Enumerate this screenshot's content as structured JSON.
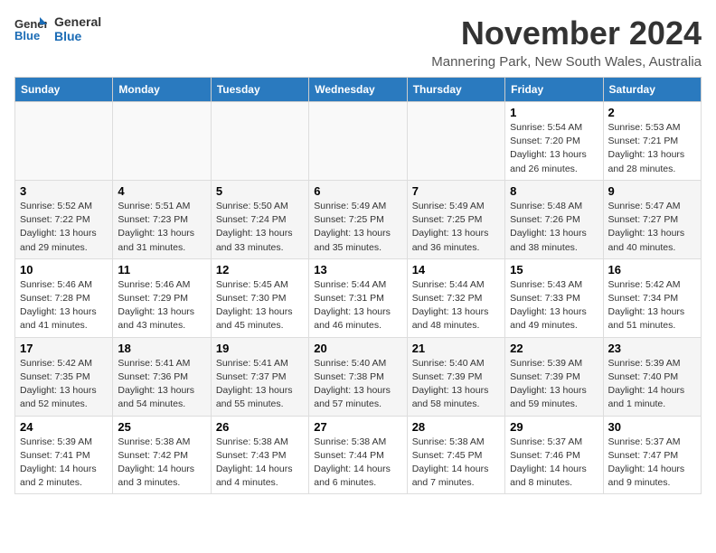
{
  "logo": {
    "line1": "General",
    "line2": "Blue"
  },
  "title": "November 2024",
  "location": "Mannering Park, New South Wales, Australia",
  "weekdays": [
    "Sunday",
    "Monday",
    "Tuesday",
    "Wednesday",
    "Thursday",
    "Friday",
    "Saturday"
  ],
  "weeks": [
    [
      {
        "day": "",
        "info": ""
      },
      {
        "day": "",
        "info": ""
      },
      {
        "day": "",
        "info": ""
      },
      {
        "day": "",
        "info": ""
      },
      {
        "day": "",
        "info": ""
      },
      {
        "day": "1",
        "info": "Sunrise: 5:54 AM\nSunset: 7:20 PM\nDaylight: 13 hours\nand 26 minutes."
      },
      {
        "day": "2",
        "info": "Sunrise: 5:53 AM\nSunset: 7:21 PM\nDaylight: 13 hours\nand 28 minutes."
      }
    ],
    [
      {
        "day": "3",
        "info": "Sunrise: 5:52 AM\nSunset: 7:22 PM\nDaylight: 13 hours\nand 29 minutes."
      },
      {
        "day": "4",
        "info": "Sunrise: 5:51 AM\nSunset: 7:23 PM\nDaylight: 13 hours\nand 31 minutes."
      },
      {
        "day": "5",
        "info": "Sunrise: 5:50 AM\nSunset: 7:24 PM\nDaylight: 13 hours\nand 33 minutes."
      },
      {
        "day": "6",
        "info": "Sunrise: 5:49 AM\nSunset: 7:25 PM\nDaylight: 13 hours\nand 35 minutes."
      },
      {
        "day": "7",
        "info": "Sunrise: 5:49 AM\nSunset: 7:25 PM\nDaylight: 13 hours\nand 36 minutes."
      },
      {
        "day": "8",
        "info": "Sunrise: 5:48 AM\nSunset: 7:26 PM\nDaylight: 13 hours\nand 38 minutes."
      },
      {
        "day": "9",
        "info": "Sunrise: 5:47 AM\nSunset: 7:27 PM\nDaylight: 13 hours\nand 40 minutes."
      }
    ],
    [
      {
        "day": "10",
        "info": "Sunrise: 5:46 AM\nSunset: 7:28 PM\nDaylight: 13 hours\nand 41 minutes."
      },
      {
        "day": "11",
        "info": "Sunrise: 5:46 AM\nSunset: 7:29 PM\nDaylight: 13 hours\nand 43 minutes."
      },
      {
        "day": "12",
        "info": "Sunrise: 5:45 AM\nSunset: 7:30 PM\nDaylight: 13 hours\nand 45 minutes."
      },
      {
        "day": "13",
        "info": "Sunrise: 5:44 AM\nSunset: 7:31 PM\nDaylight: 13 hours\nand 46 minutes."
      },
      {
        "day": "14",
        "info": "Sunrise: 5:44 AM\nSunset: 7:32 PM\nDaylight: 13 hours\nand 48 minutes."
      },
      {
        "day": "15",
        "info": "Sunrise: 5:43 AM\nSunset: 7:33 PM\nDaylight: 13 hours\nand 49 minutes."
      },
      {
        "day": "16",
        "info": "Sunrise: 5:42 AM\nSunset: 7:34 PM\nDaylight: 13 hours\nand 51 minutes."
      }
    ],
    [
      {
        "day": "17",
        "info": "Sunrise: 5:42 AM\nSunset: 7:35 PM\nDaylight: 13 hours\nand 52 minutes."
      },
      {
        "day": "18",
        "info": "Sunrise: 5:41 AM\nSunset: 7:36 PM\nDaylight: 13 hours\nand 54 minutes."
      },
      {
        "day": "19",
        "info": "Sunrise: 5:41 AM\nSunset: 7:37 PM\nDaylight: 13 hours\nand 55 minutes."
      },
      {
        "day": "20",
        "info": "Sunrise: 5:40 AM\nSunset: 7:38 PM\nDaylight: 13 hours\nand 57 minutes."
      },
      {
        "day": "21",
        "info": "Sunrise: 5:40 AM\nSunset: 7:39 PM\nDaylight: 13 hours\nand 58 minutes."
      },
      {
        "day": "22",
        "info": "Sunrise: 5:39 AM\nSunset: 7:39 PM\nDaylight: 13 hours\nand 59 minutes."
      },
      {
        "day": "23",
        "info": "Sunrise: 5:39 AM\nSunset: 7:40 PM\nDaylight: 14 hours\nand 1 minute."
      }
    ],
    [
      {
        "day": "24",
        "info": "Sunrise: 5:39 AM\nSunset: 7:41 PM\nDaylight: 14 hours\nand 2 minutes."
      },
      {
        "day": "25",
        "info": "Sunrise: 5:38 AM\nSunset: 7:42 PM\nDaylight: 14 hours\nand 3 minutes."
      },
      {
        "day": "26",
        "info": "Sunrise: 5:38 AM\nSunset: 7:43 PM\nDaylight: 14 hours\nand 4 minutes."
      },
      {
        "day": "27",
        "info": "Sunrise: 5:38 AM\nSunset: 7:44 PM\nDaylight: 14 hours\nand 6 minutes."
      },
      {
        "day": "28",
        "info": "Sunrise: 5:38 AM\nSunset: 7:45 PM\nDaylight: 14 hours\nand 7 minutes."
      },
      {
        "day": "29",
        "info": "Sunrise: 5:37 AM\nSunset: 7:46 PM\nDaylight: 14 hours\nand 8 minutes."
      },
      {
        "day": "30",
        "info": "Sunrise: 5:37 AM\nSunset: 7:47 PM\nDaylight: 14 hours\nand 9 minutes."
      }
    ]
  ]
}
